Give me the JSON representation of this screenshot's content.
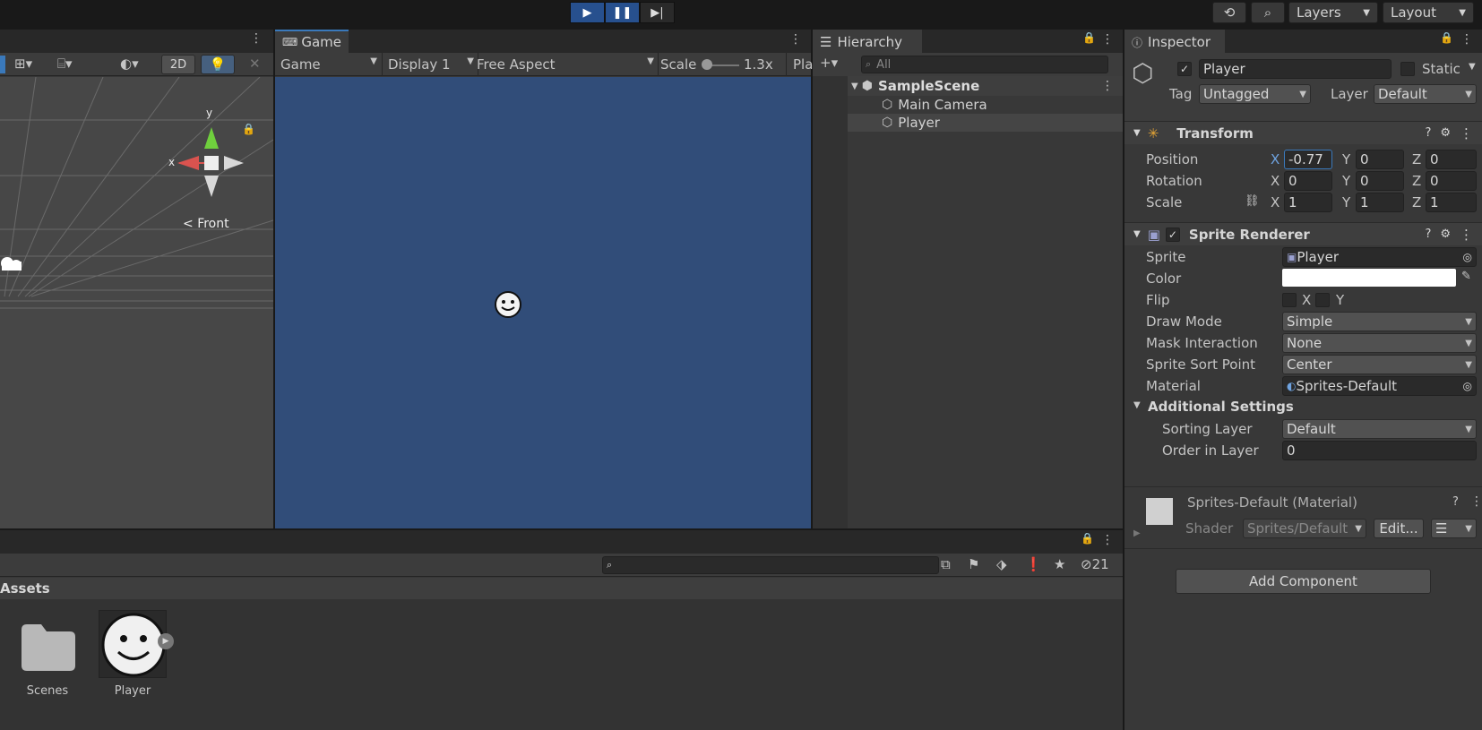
{
  "toolbar": {
    "layers": "Layers",
    "layout": "Layout"
  },
  "scene": {
    "mode_2d": "2D",
    "axis_x": "x",
    "axis_y": "y",
    "front": "Front"
  },
  "game": {
    "tab": "Game",
    "view_mode": "Game",
    "display": "Display 1",
    "aspect": "Free Aspect",
    "scale_label": "Scale",
    "scale_value": "1.3x",
    "play_label": "Pla",
    "bg_color": "#314d79"
  },
  "hierarchy": {
    "tab": "Hierarchy",
    "search_placeholder": "All",
    "scene_name": "SampleScene",
    "items": [
      "Main Camera",
      "Player"
    ]
  },
  "inspector": {
    "tab": "Inspector",
    "object_name": "Player",
    "static_label": "Static",
    "tag_label": "Tag",
    "tag_value": "Untagged",
    "layer_label": "Layer",
    "layer_value": "Default",
    "transform": {
      "title": "Transform",
      "position": {
        "label": "Position",
        "x": "-0.77",
        "y": "0",
        "z": "0"
      },
      "rotation": {
        "label": "Rotation",
        "x": "0",
        "y": "0",
        "z": "0"
      },
      "scale": {
        "label": "Scale",
        "x": "1",
        "y": "1",
        "z": "1"
      },
      "axis_x": "X",
      "axis_y": "Y",
      "axis_z": "Z"
    },
    "sprite_renderer": {
      "title": "Sprite Renderer",
      "sprite_label": "Sprite",
      "sprite_value": "Player",
      "color_label": "Color",
      "color_value": "#ffffff",
      "flip_label": "Flip",
      "flip_x": "X",
      "flip_y": "Y",
      "draw_mode_label": "Draw Mode",
      "draw_mode_value": "Simple",
      "mask_label": "Mask Interaction",
      "mask_value": "None",
      "sort_point_label": "Sprite Sort Point",
      "sort_point_value": "Center",
      "material_label": "Material",
      "material_value": "Sprites-Default",
      "additional_label": "Additional Settings",
      "sorting_layer_label": "Sorting Layer",
      "sorting_layer_value": "Default",
      "order_label": "Order in Layer",
      "order_value": "0"
    },
    "material": {
      "title": "Sprites-Default (Material)",
      "shader_label": "Shader",
      "shader_value": "Sprites/Default",
      "edit_label": "Edit..."
    },
    "add_component": "Add Component"
  },
  "project": {
    "hidden_count": "21",
    "breadcrumb": "Assets",
    "assets": [
      "Scenes",
      "Player"
    ]
  }
}
